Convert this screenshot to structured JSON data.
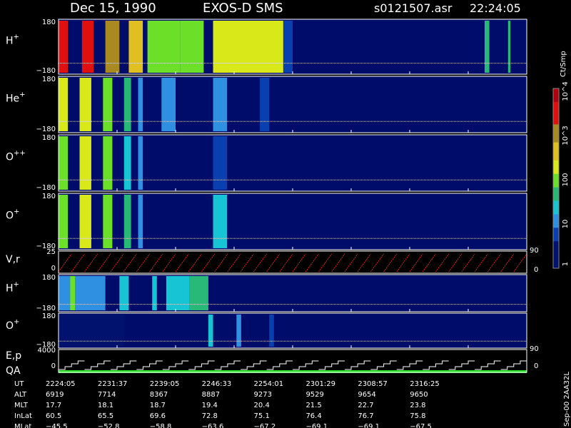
{
  "header": {
    "date": "Dec 15, 1990",
    "mission": "EXOS-D  SMS",
    "file": "s0121507.asr",
    "time": "22:24:05"
  },
  "colorbar": {
    "title": "Ct/Smp",
    "tick_labels": [
      "10^4",
      "10^3",
      "100",
      "10",
      "1"
    ]
  },
  "footer_tag": "Sep-00  2AA32L",
  "chart_data": {
    "type": "heatmap",
    "panels": [
      {
        "label": "H",
        "sup": "+",
        "y_top": "180",
        "y_bottom": "−180",
        "bands": [
          {
            "x0": 0.0,
            "x1": 0.02,
            "level": 3.4
          },
          {
            "x0": 0.05,
            "x1": 0.075,
            "level": 3.6
          },
          {
            "x0": 0.1,
            "x1": 0.13,
            "level": 2.8
          },
          {
            "x0": 0.15,
            "x1": 0.18,
            "level": 2.4
          },
          {
            "x0": 0.19,
            "x1": 0.26,
            "level": 1.8
          },
          {
            "x0": 0.26,
            "x1": 0.31,
            "level": 2.0
          },
          {
            "x0": 0.33,
            "x1": 0.48,
            "level": 2.3
          },
          {
            "x0": 0.48,
            "x1": 0.5,
            "level": 0.7
          },
          {
            "x0": 0.91,
            "x1": 0.92,
            "level": 1.6
          },
          {
            "x0": 0.96,
            "x1": 0.965,
            "level": 1.6
          }
        ]
      },
      {
        "label": "He",
        "sup": "+",
        "y_top": "180",
        "y_bottom": "−180",
        "bands": [
          {
            "x0": 0.0,
            "x1": 0.02,
            "level": 2.2
          },
          {
            "x0": 0.045,
            "x1": 0.07,
            "level": 2.3
          },
          {
            "x0": 0.095,
            "x1": 0.115,
            "level": 2.0
          },
          {
            "x0": 0.14,
            "x1": 0.155,
            "level": 1.6
          },
          {
            "x0": 0.17,
            "x1": 0.18,
            "level": 1.0
          },
          {
            "x0": 0.22,
            "x1": 0.25,
            "level": 1.0
          },
          {
            "x0": 0.33,
            "x1": 0.36,
            "level": 1.0
          },
          {
            "x0": 0.43,
            "x1": 0.45,
            "level": 0.8
          }
        ]
      },
      {
        "label": "O",
        "sup": "++",
        "y_top": "180",
        "y_bottom": "−180",
        "bands": [
          {
            "x0": 0.0,
            "x1": 0.02,
            "level": 2.0
          },
          {
            "x0": 0.045,
            "x1": 0.07,
            "level": 2.2
          },
          {
            "x0": 0.095,
            "x1": 0.115,
            "level": 1.9
          },
          {
            "x0": 0.14,
            "x1": 0.155,
            "level": 1.4
          },
          {
            "x0": 0.17,
            "x1": 0.18,
            "level": 0.9
          },
          {
            "x0": 0.33,
            "x1": 0.36,
            "level": 0.8
          }
        ]
      },
      {
        "label": "O",
        "sup": "+",
        "y_top": "180",
        "y_bottom": "−180",
        "bands": [
          {
            "x0": 0.0,
            "x1": 0.02,
            "level": 2.0
          },
          {
            "x0": 0.045,
            "x1": 0.07,
            "level": 2.3
          },
          {
            "x0": 0.095,
            "x1": 0.115,
            "level": 2.0
          },
          {
            "x0": 0.14,
            "x1": 0.155,
            "level": 1.6
          },
          {
            "x0": 0.17,
            "x1": 0.18,
            "level": 1.1
          },
          {
            "x0": 0.33,
            "x1": 0.36,
            "level": 1.3
          }
        ]
      },
      {
        "label": "H",
        "sup": "+",
        "y_top": "180",
        "y_bottom": "−180",
        "bands": [
          {
            "x0": 0.0,
            "x1": 0.1,
            "level": 0.9
          },
          {
            "x0": 0.025,
            "x1": 0.035,
            "level": 1.8
          },
          {
            "x0": 0.13,
            "x1": 0.15,
            "level": 1.2
          },
          {
            "x0": 0.2,
            "x1": 0.21,
            "level": 1.4
          },
          {
            "x0": 0.23,
            "x1": 0.28,
            "level": 1.3
          },
          {
            "x0": 0.28,
            "x1": 0.32,
            "level": 1.6
          }
        ]
      },
      {
        "label": "O",
        "sup": "+",
        "y_top": "180",
        "y_bottom": "−180",
        "bands": [
          {
            "x0": 0.0,
            "x1": 0.14,
            "level": 0.5
          },
          {
            "x0": 0.32,
            "x1": 0.33,
            "level": 1.4
          },
          {
            "x0": 0.38,
            "x1": 0.39,
            "level": 0.9
          },
          {
            "x0": 0.45,
            "x1": 0.46,
            "level": 0.8
          }
        ]
      }
    ],
    "vr_panel": {
      "label": "V,r",
      "ticks": [
        "25",
        "0"
      ],
      "right_ticks": [
        "90",
        "0"
      ]
    },
    "ep_panel": {
      "label_top": "E,p",
      "label_bottom": "QA",
      "ticks": [
        "4000",
        "0"
      ],
      "right_ticks": [
        "90",
        "0"
      ]
    },
    "colorscale_range": [
      0,
      4
    ],
    "timeline": {
      "rows": [
        {
          "name": "UT",
          "values": [
            "2224:05",
            "2231:37",
            "2239:05",
            "2246:33",
            "2254:01",
            "2301:29",
            "2308:57",
            "2316:25"
          ]
        },
        {
          "name": "ALT",
          "values": [
            "6919",
            "7714",
            "8367",
            "8887",
            "9273",
            "9529",
            "9654",
            "9650"
          ]
        },
        {
          "name": "MLT",
          "values": [
            "17.7",
            "18.1",
            "18.7",
            "19.4",
            "20.4",
            "21.5",
            "22.7",
            "23.8"
          ]
        },
        {
          "name": "InLat",
          "values": [
            "60.5",
            "65.5",
            "69.6",
            "72.8",
            "75.1",
            "76.4",
            "76.7",
            "75.8"
          ]
        },
        {
          "name": "MLat",
          "values": [
            "−45.5",
            "−52.8",
            "−58.8",
            "−63.6",
            "−67.2",
            "−69.1",
            "−69.1",
            "−67.5"
          ]
        }
      ]
    }
  }
}
